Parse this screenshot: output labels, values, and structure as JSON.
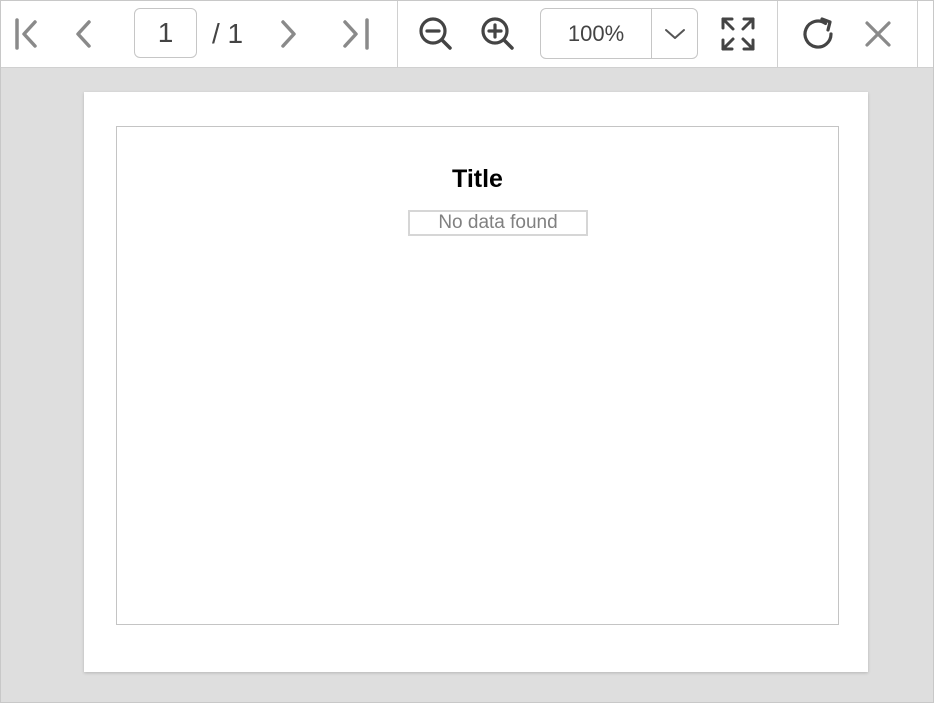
{
  "toolbar": {
    "buttons": [
      {
        "name": "first-page",
        "icon": "first-page-icon"
      },
      {
        "name": "previous-page",
        "icon": "chevron-left-icon"
      },
      {
        "name": "next-page",
        "icon": "chevron-right-icon"
      },
      {
        "name": "last-page",
        "icon": "last-page-icon"
      },
      {
        "name": "zoom-out",
        "icon": "zoom-out-icon"
      },
      {
        "name": "zoom-in",
        "icon": "zoom-in-icon"
      },
      {
        "name": "fit-page",
        "icon": "expand-icon"
      },
      {
        "name": "refresh",
        "icon": "refresh-icon"
      },
      {
        "name": "close",
        "icon": "close-icon"
      }
    ],
    "page_number": "1",
    "page_total": "/ 1",
    "zoom_value": "100%",
    "icon_color_dark": "#444444",
    "icon_color_light": "#8a8a8a"
  },
  "report": {
    "title": "Title",
    "empty_message": "No data found"
  },
  "colors": {
    "viewer_background": "#dedede",
    "page_background": "#ffffff",
    "border": "#c4c4c4"
  }
}
